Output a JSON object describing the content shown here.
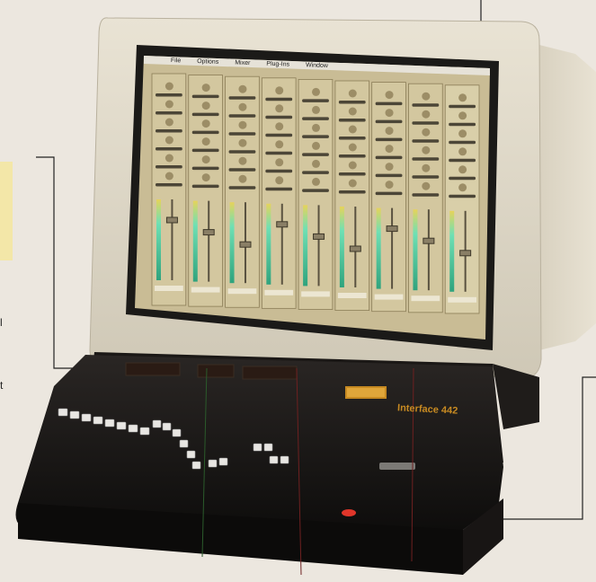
{
  "screen": {
    "menu_items": [
      "File",
      "Options",
      "Mixer",
      "Plug-Ins",
      "Window"
    ],
    "strip_count": 9
  },
  "console": {
    "brand": "Interface 442"
  },
  "margin_text": {
    "line1": "l",
    "line2": "t"
  },
  "colors": {
    "background": "#ece7df",
    "monitor_beige": "#dcd5c4",
    "console_black": "#151312",
    "screen_bg": "#c9bc95",
    "meter_green": "#4fc49a",
    "accent_orange": "#c78a22"
  }
}
